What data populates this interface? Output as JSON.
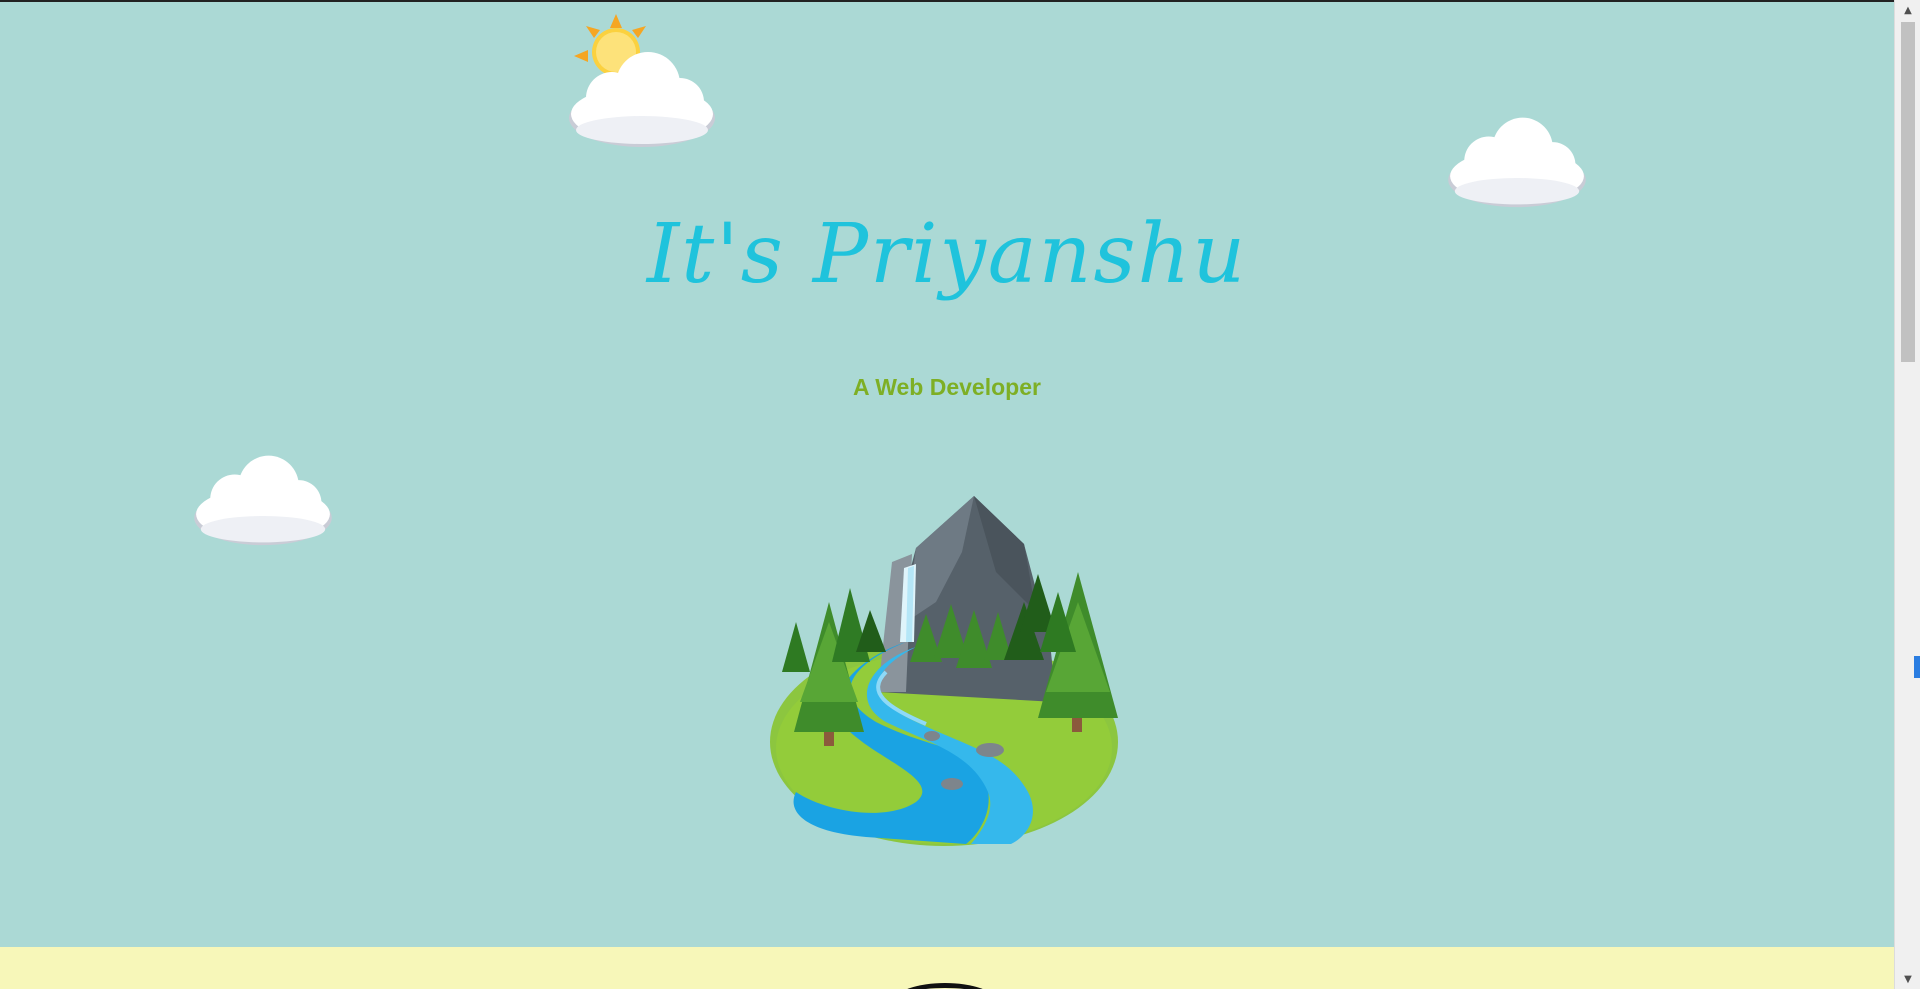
{
  "hero": {
    "title": "It's Priyanshu",
    "subtitle": "A Web Developer",
    "background_color": "#abd9d5",
    "title_color": "#1fc3dc",
    "subtitle_color": "#7eaf25"
  },
  "decorations": {
    "sun_icon": "sun-behind-cloud-icon",
    "cloud_icon": "cloud-icon",
    "landscape_icon": "mountain-river-island-icon"
  },
  "next_section": {
    "background_color": "#f7f7b9"
  },
  "scrollbar": {
    "up_arrow": "▲",
    "down_arrow": "▼"
  }
}
